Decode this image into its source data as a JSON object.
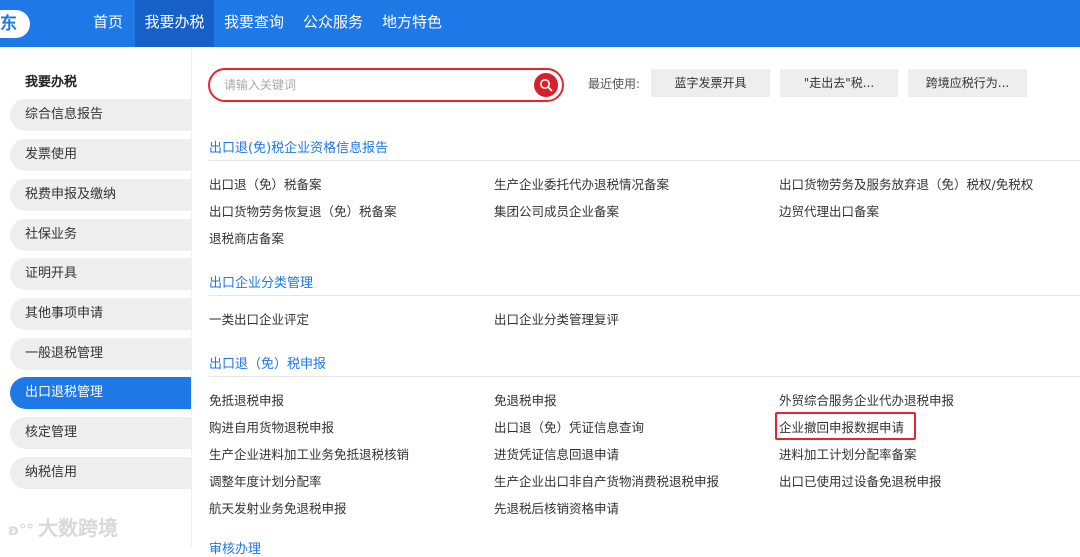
{
  "topbar": {
    "region": "东",
    "nav": [
      "首页",
      "我要办税",
      "我要查询",
      "公众服务",
      "地方特色"
    ],
    "active_nav": "我要办税",
    "color": "#1e78e6"
  },
  "sidebar": {
    "title": "我要办税",
    "items": [
      "综合信息报告",
      "发票使用",
      "税费申报及缴纳",
      "社保业务",
      "证明开具",
      "其他事项申请",
      "一般退税管理",
      "出口退税管理",
      "核定管理",
      "纳税信用"
    ],
    "active_item": "出口退税管理"
  },
  "search": {
    "placeholder": "请输入关键词"
  },
  "recent": {
    "label": "最近使用:",
    "items": [
      "蓝字发票开具",
      "\"走出去\"税...",
      "跨境应税行为..."
    ]
  },
  "sections": [
    {
      "title": "出口退(免)税企业资格信息报告",
      "links": [
        "出口退（免）税备案",
        "生产企业委托代办退税情况备案",
        "出口货物劳务及服务放弃退（免）税权/免税权",
        "出口货物劳务恢复退（免）税备案",
        "集团公司成员企业备案",
        "边贸代理出口备案",
        "退税商店备案"
      ]
    },
    {
      "title": "出口企业分类管理",
      "links": [
        "一类出口企业评定",
        "出口企业分类管理复评"
      ]
    },
    {
      "title": "出口退（免）税申报",
      "links": [
        "免抵退税申报",
        "免退税申报",
        "外贸综合服务企业代办退税申报",
        "购进自用货物退税申报",
        "出口退（免）凭证信息查询",
        "企业撤回申报数据申请",
        "生产企业进料加工业务免抵退税核销",
        "进货凭证信息回退申请",
        "进料加工计划分配率备案",
        "调整年度计划分配率",
        "生产企业出口非自产货物消费税退税申报",
        "出口已使用过设备免退税申报",
        "航天发射业务免退税申报",
        "先退税后核销资格申请"
      ]
    }
  ],
  "next_section_partial": "审核办理",
  "watermark": "大数跨境",
  "highlight_color": "#e6262f"
}
